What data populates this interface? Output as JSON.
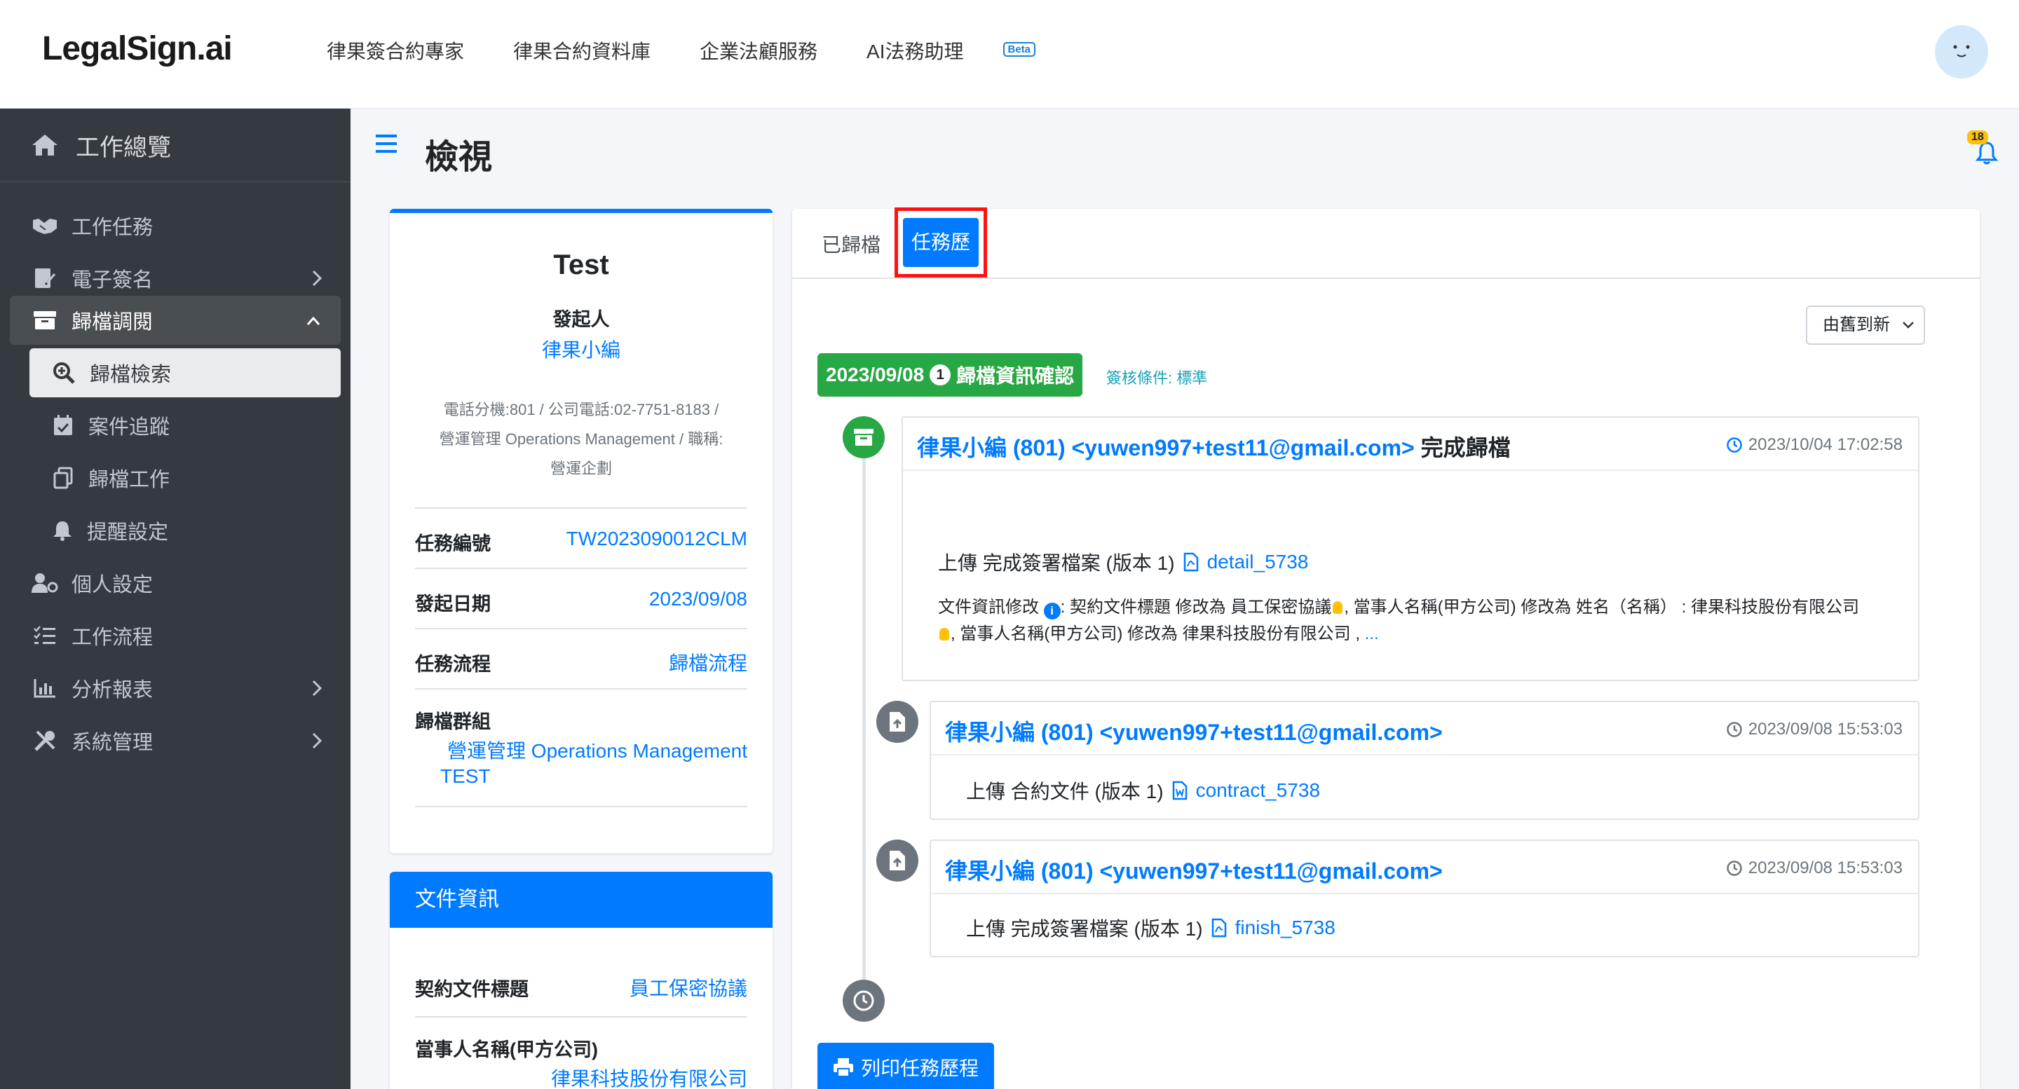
{
  "brand": {
    "logo": "LegalSign.ai"
  },
  "topnav": {
    "items": [
      "律果簽合約專家",
      "律果合約資料庫",
      "企業法顧服務",
      "AI法務助理"
    ],
    "beta": "Beta"
  },
  "sidebar": {
    "header": "工作總覽",
    "items": {
      "tasks": "工作任務",
      "esign": "電子簽名",
      "archive": "歸檔調閱",
      "archive_search": "歸檔檢索",
      "case_tracking": "案件追蹤",
      "archive_work": "歸檔工作",
      "reminder": "提醒設定",
      "personal": "個人設定",
      "workflow": "工作流程",
      "reports": "分析報表",
      "system": "系統管理"
    }
  },
  "page": {
    "title": "檢視",
    "notification_count": "18"
  },
  "info_card": {
    "title": "Test",
    "initiator_label": "發起人",
    "initiator_name": "律果小編",
    "contact_line1": "電話分機:801 / 公司電話:02-7751-8183 /",
    "contact_line2": "營運管理 Operations Management / 職稱:",
    "contact_line3": "營運企劃",
    "task_no_label": "任務編號",
    "task_no": "TW2023090012CLM",
    "start_date_label": "發起日期",
    "start_date": "2023/09/08",
    "workflow_label": "任務流程",
    "workflow": "歸檔流程",
    "group_label": "歸檔群組",
    "group_line1": "營運管理 Operations Management",
    "group_line2": "TEST"
  },
  "doc_card": {
    "header": "文件資訊",
    "title_label": "契約文件標題",
    "title_value": "員工保密協議",
    "party_label": "當事人名稱(甲方公司)",
    "party_value": "律果科技股份有限公司"
  },
  "tabs": {
    "archived": "已歸檔",
    "history": "任務歷程"
  },
  "sort": {
    "selected": "由舊到新"
  },
  "timeline": {
    "date": "2023/09/08",
    "step_no": "1",
    "step_label": "歸檔資訊確認",
    "condition": "簽核條件: 標準",
    "entries": [
      {
        "actor": "律果小編 (801) <yuwen997+test11@gmail.com>",
        "action": " 完成歸檔",
        "time": "2023/10/04 17:02:58",
        "text": "上傳 完成簽署檔案 (版本 1)",
        "file": "detail_5738",
        "detail_prefix": "文件資訊修改",
        "detail_a": ": 契約文件標題 修改為 員工保密協議",
        "detail_b": ", 當事人名稱(甲方公司) 修改為 姓名（名稱） : 律果科技股份有限公司",
        "detail_c": ", 當事人名稱(甲方公司) 修改為 律果科技股份有限公司 ,",
        "more": "..."
      },
      {
        "actor": "律果小編 (801) <yuwen997+test11@gmail.com>",
        "time": "2023/09/08 15:53:03",
        "text": "上傳 合約文件 (版本 1)",
        "file": "contract_5738"
      },
      {
        "actor": "律果小編 (801) <yuwen997+test11@gmail.com>",
        "time": "2023/09/08 15:53:03",
        "text": "上傳 完成簽署檔案 (版本 1)",
        "file": "finish_5738"
      }
    ]
  },
  "print_button": "列印任務歷程",
  "colors": {
    "primary": "#007bff",
    "success": "#28a745",
    "sidebar": "#343a40",
    "highlight": "#ff1111"
  }
}
